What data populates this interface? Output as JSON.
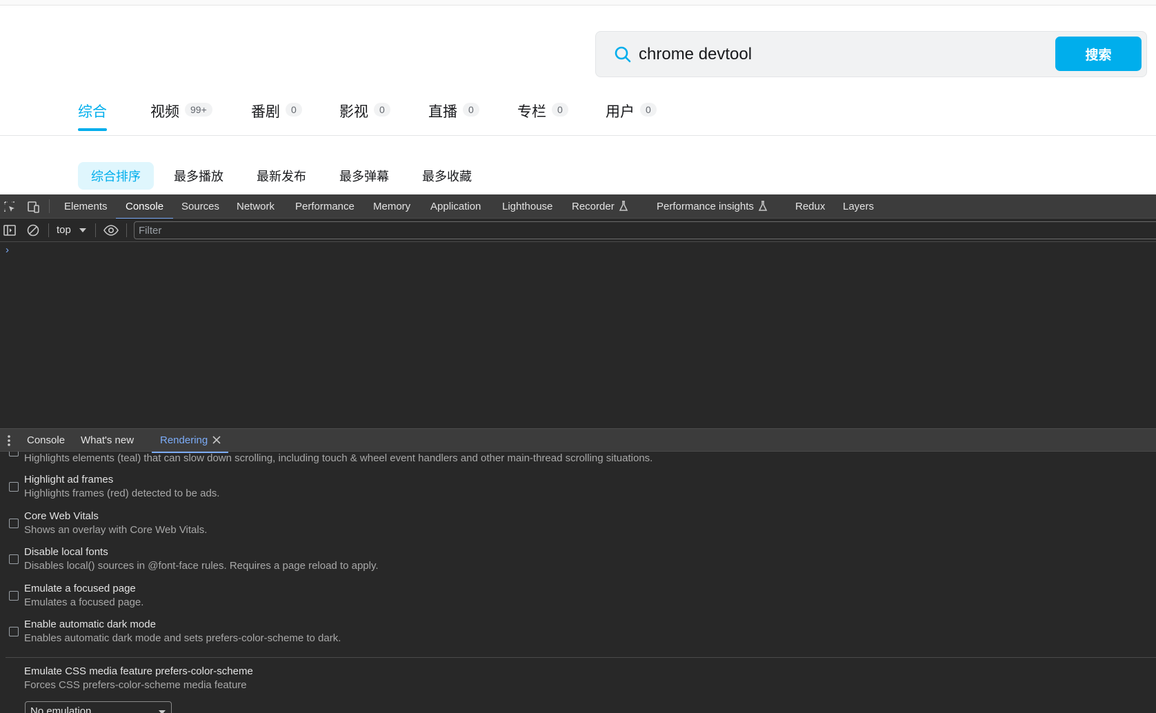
{
  "search": {
    "query": "chrome devtool",
    "button_label": "搜索"
  },
  "tabs": [
    {
      "label": "综合",
      "count": ""
    },
    {
      "label": "视频",
      "count": "99+"
    },
    {
      "label": "番剧",
      "count": "0"
    },
    {
      "label": "影视",
      "count": "0"
    },
    {
      "label": "直播",
      "count": "0"
    },
    {
      "label": "专栏",
      "count": "0"
    },
    {
      "label": "用户",
      "count": "0"
    }
  ],
  "sort_options": [
    "综合排序",
    "最多播放",
    "最新发布",
    "最多弹幕",
    "最多收藏"
  ],
  "devtools": {
    "panels": [
      "Elements",
      "Console",
      "Sources",
      "Network",
      "Performance",
      "Memory",
      "Application",
      "Lighthouse",
      "Recorder",
      "Performance insights",
      "Redux",
      "Layers"
    ],
    "active_panel": "Console",
    "context": "top",
    "filter_placeholder": "Filter",
    "prompt": "›",
    "drawer_tabs": [
      "Console",
      "What's new",
      "Rendering"
    ],
    "active_drawer_tab": "Rendering",
    "rendering_options": [
      {
        "title": "",
        "desc": "Highlights elements (teal) that can slow down scrolling, including touch & wheel event handlers and other main-thread scrolling situations."
      },
      {
        "title": "Highlight ad frames",
        "desc": "Highlights frames (red) detected to be ads."
      },
      {
        "title": "Core Web Vitals",
        "desc": "Shows an overlay with Core Web Vitals."
      },
      {
        "title": "Disable local fonts",
        "desc": "Disables local() sources in @font-face rules. Requires a page reload to apply."
      },
      {
        "title": "Emulate a focused page",
        "desc": "Emulates a focused page."
      },
      {
        "title": "Enable automatic dark mode",
        "desc": "Enables automatic dark mode and sets prefers-color-scheme to dark."
      }
    ],
    "media_feature": {
      "title": "Emulate CSS media feature prefers-color-scheme",
      "desc": "Forces CSS prefers-color-scheme media feature",
      "selected": "No emulation"
    }
  },
  "colors": {
    "accent": "#00aeec",
    "devtools_bg": "#282828",
    "devtools_link": "#7cacf8"
  }
}
